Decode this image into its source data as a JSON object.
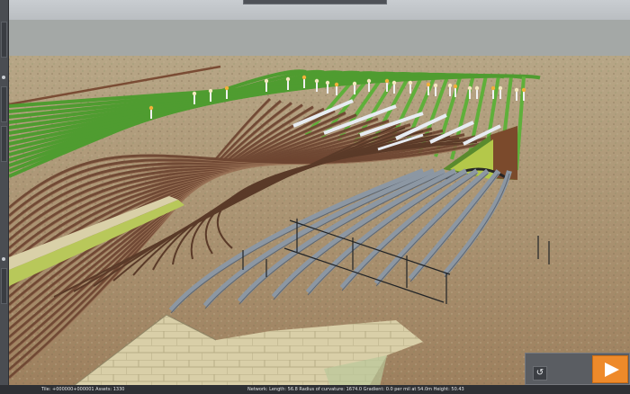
{
  "status_bar": {
    "left_text": "Tile: +000000+000001  Assets: 1330",
    "right_text": "Network:  Length: 56.8 Radius of curvature: 1674.0 Gradient: 0.0 per mil at 54.0m Height: 50.43"
  },
  "controls": {
    "play_icon": "play-icon",
    "tool_icon": "curve-tool-icon",
    "tool_glyph": "↺"
  },
  "colors": {
    "accent": "#ee8a2a",
    "sky": "#b8bcc0",
    "ground": "#a88f6e",
    "grass_track": "#5aa836",
    "rail_bed": "#6e4a32",
    "concrete": "#8c97a3"
  }
}
